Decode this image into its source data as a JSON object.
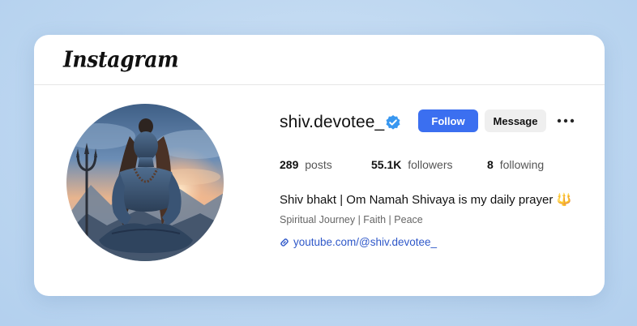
{
  "header": {
    "logo_text": "Instagram"
  },
  "profile": {
    "username": "shiv.devotee_",
    "verified": true,
    "avatar_icon": "profile-photo-meditating-deity-icon"
  },
  "actions": {
    "follow_label": "Follow",
    "message_label": "Message",
    "more_icon": "more-options-icon"
  },
  "stats": {
    "posts": {
      "value": "289",
      "label": "posts"
    },
    "followers": {
      "value": "55.1K",
      "label": "followers"
    },
    "following": {
      "value": "8",
      "label": "following"
    }
  },
  "bio": {
    "line": "Shiv bhakt | Om Namah Shivaya is my daily prayer 🔱",
    "tags": "Spiritual Journey | Faith | Peace",
    "link": "youtube.com/@shiv.devotee_",
    "link_icon": "link-icon"
  },
  "colors": {
    "accent": "#3b6ff0",
    "link": "#2f58c9",
    "verified": "#3897f0",
    "background": "#c3daf1"
  }
}
